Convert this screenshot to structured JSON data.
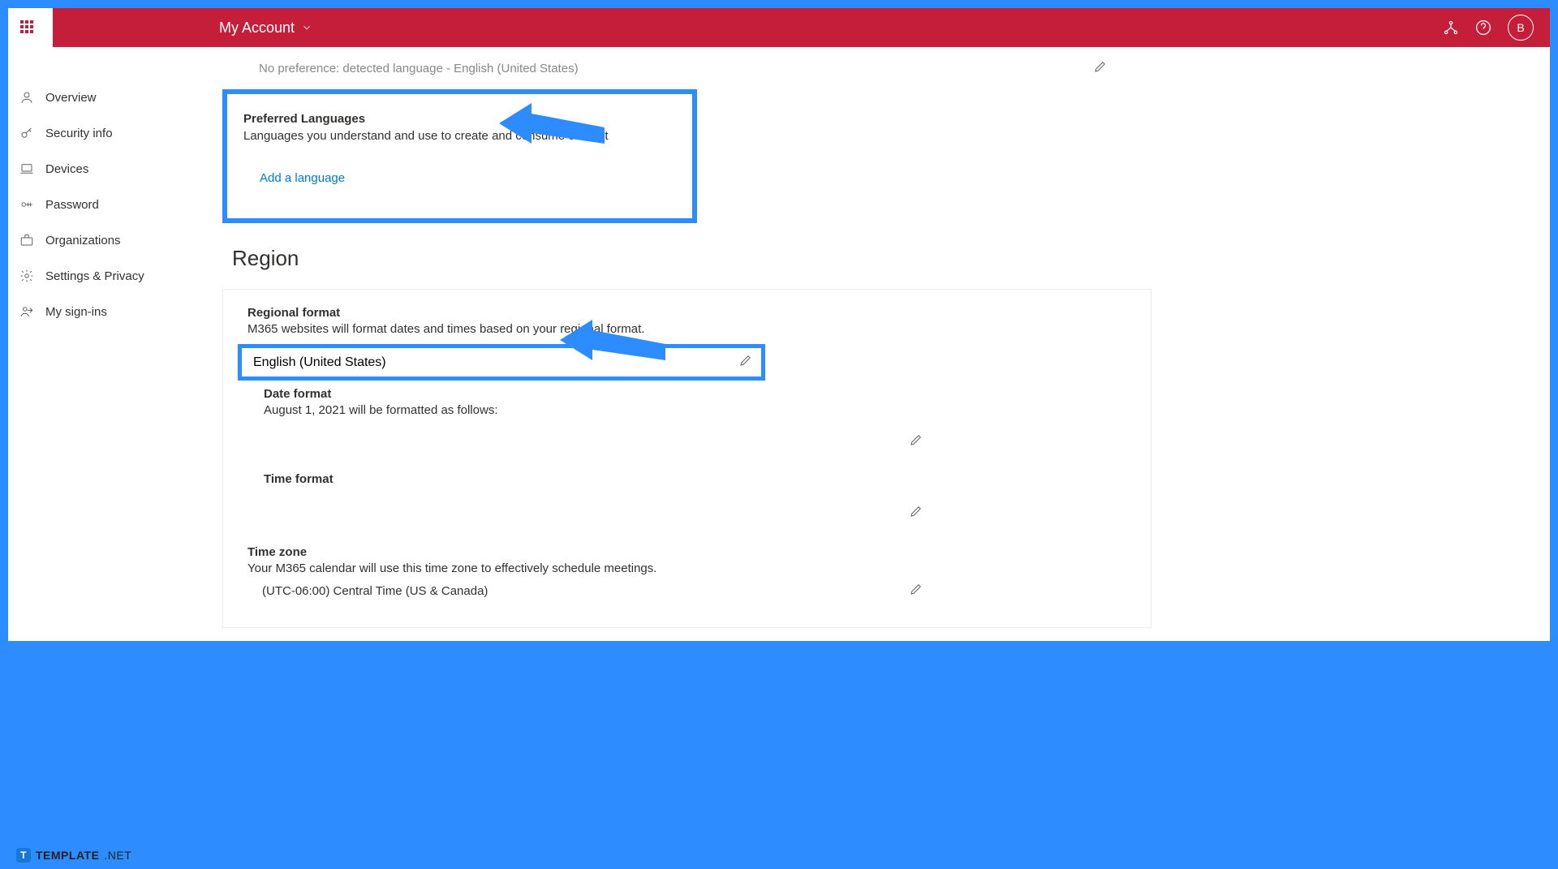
{
  "header": {
    "page_title": "My Account",
    "avatar_initial": "B"
  },
  "sidebar": {
    "items": [
      {
        "label": "Overview"
      },
      {
        "label": "Security info"
      },
      {
        "label": "Devices"
      },
      {
        "label": "Password"
      },
      {
        "label": "Organizations"
      },
      {
        "label": "Settings & Privacy"
      },
      {
        "label": "My sign-ins"
      }
    ]
  },
  "detected": {
    "text": "No preference: detected language - English (United States)"
  },
  "preferred_languages": {
    "title": "Preferred Languages",
    "desc": "Languages you understand and use to create and consume content",
    "add_link": "Add a language"
  },
  "region": {
    "heading": "Region",
    "regional_format": {
      "title": "Regional format",
      "desc": "M365 websites will format dates and times based on your regional format.",
      "value": "English (United States)"
    },
    "date_format": {
      "title": "Date format",
      "desc": "August 1, 2021 will be formatted as follows:"
    },
    "time_format": {
      "title": "Time format"
    },
    "time_zone": {
      "title": "Time zone",
      "desc": "Your M365 calendar will use this time zone to effectively schedule meetings.",
      "value": "(UTC-06:00) Central Time (US & Canada)"
    }
  },
  "watermark": {
    "brand": "TEMPLATE",
    "suffix": ".NET"
  }
}
